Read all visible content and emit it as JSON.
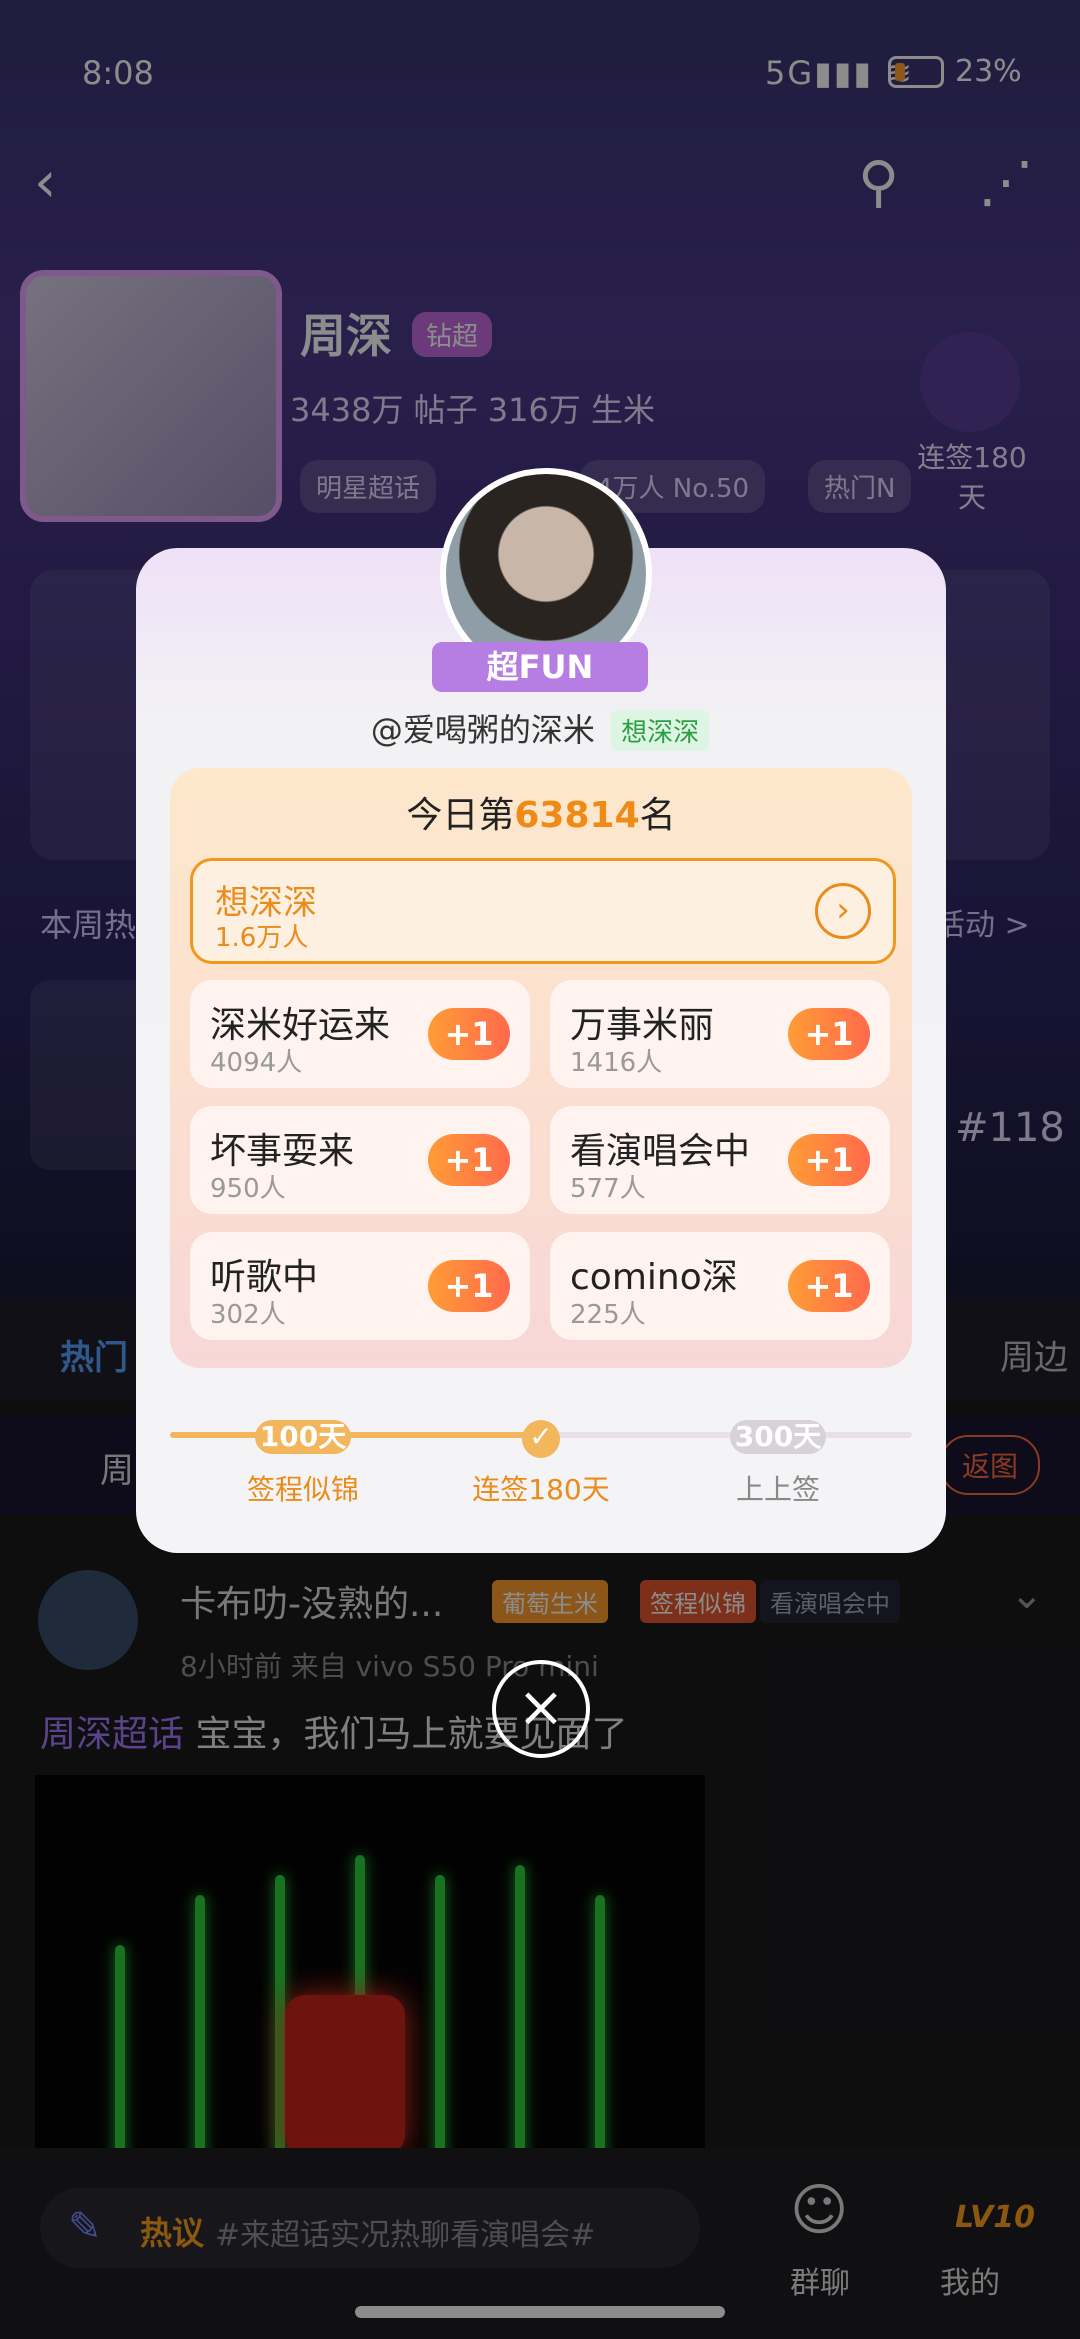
{
  "status": {
    "time": "8:08",
    "signal": "5G",
    "battery": "23%"
  },
  "header": {
    "name": "周深",
    "badge": "钻超",
    "stats": "3438万 帖子  316万 生米",
    "chips": [
      "明星超话",
      "4万人 No.50",
      "热门N"
    ],
    "checkin_label": "连签180\n天"
  },
  "weekly": {
    "left": "本周热",
    "right": "活动 >",
    "number": "#118"
  },
  "tabs": [
    "热门",
    "周边"
  ],
  "marquee": {
    "left": "周",
    "button": "返图"
  },
  "post": {
    "author": "卡布叻-没熟的...",
    "tags": [
      "葡萄生米",
      "签程似锦",
      "看演唱会中"
    ],
    "meta": "8小时前  来自 vivo S50 Pro mini",
    "topic": "周深超话",
    "text": "宝宝，我们马上就要见面了"
  },
  "bottom": {
    "hot_label": "热议",
    "comment_placeholder": "#来超话实况热聊看演唱会#",
    "nav": [
      "群聊",
      "我的"
    ],
    "level": "LV10"
  },
  "modal": {
    "fun_badge": "超FUN",
    "username": "@爱喝粥的深米",
    "user_tag": "想深深",
    "rank_prefix": "今日第",
    "rank_number": "63814",
    "rank_suffix": "名",
    "main_option": {
      "title": "想深深",
      "count": "1.6万人"
    },
    "options": [
      {
        "title": "深米好运来",
        "count": "4094人"
      },
      {
        "title": "万事米丽",
        "count": "1416人"
      },
      {
        "title": "坏事耍来",
        "count": "950人"
      },
      {
        "title": "看演唱会中",
        "count": "577人"
      },
      {
        "title": "听歌中",
        "count": "302人"
      },
      {
        "title": "comino深",
        "count": "225人"
      }
    ],
    "plus_label": "+1",
    "progress": {
      "nodes": [
        {
          "top": "100天",
          "label": "签程似锦"
        },
        {
          "top": "✓",
          "label": "连签180天"
        },
        {
          "top": "300天",
          "label": "上上签"
        }
      ]
    }
  },
  "colors": {
    "accent": "#f08a16",
    "purple": "#b67ee2",
    "green": "#2b9f45"
  }
}
